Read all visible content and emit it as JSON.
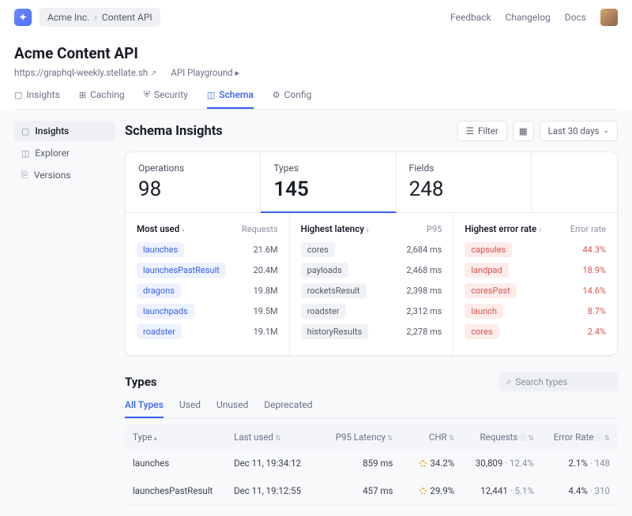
{
  "topbar": {
    "org": "Acme Inc.",
    "project": "Content API",
    "links": [
      "Feedback",
      "Changelog",
      "Docs"
    ]
  },
  "header": {
    "title": "Acme Content API",
    "url": "https://graphql-weekly.stellate.sh",
    "playground": "API Playground"
  },
  "tabs": [
    {
      "label": "Insights"
    },
    {
      "label": "Caching"
    },
    {
      "label": "Security"
    },
    {
      "label": "Schema",
      "active": true
    },
    {
      "label": "Config"
    }
  ],
  "side": [
    {
      "label": "Insights",
      "active": true
    },
    {
      "label": "Explorer"
    },
    {
      "label": "Versions"
    }
  ],
  "section_title": "Schema Insights",
  "filter": "Filter",
  "range": "Last 30 days",
  "stats": [
    {
      "label": "Operations",
      "value": "98"
    },
    {
      "label": "Types",
      "value": "145",
      "active": true
    },
    {
      "label": "Fields",
      "value": "248"
    }
  ],
  "lists": [
    {
      "title": "Most used",
      "metric": "Requests",
      "style": "blue",
      "rows": [
        {
          "name": "launches",
          "val": "21.6M"
        },
        {
          "name": "launchesPastResult",
          "val": "20.4M"
        },
        {
          "name": "dragons",
          "val": "19.8M"
        },
        {
          "name": "launchpads",
          "val": "19.5M"
        },
        {
          "name": "roadster",
          "val": "19.1M"
        }
      ]
    },
    {
      "title": "Highest latency",
      "metric": "P95",
      "style": "neutral",
      "rows": [
        {
          "name": "cores",
          "val": "2,684 ms"
        },
        {
          "name": "payloads",
          "val": "2,468 ms"
        },
        {
          "name": "rocketsResult",
          "val": "2,398 ms"
        },
        {
          "name": "roadster",
          "val": "2,312 ms"
        },
        {
          "name": "historyResults",
          "val": "2,278 ms"
        }
      ]
    },
    {
      "title": "Highest error rate",
      "metric": "Error rate",
      "style": "warm",
      "rows": [
        {
          "name": "capsules",
          "val": "44.3%"
        },
        {
          "name": "landpad",
          "val": "18.9%"
        },
        {
          "name": "coresPast",
          "val": "14.6%"
        },
        {
          "name": "launch",
          "val": "8.7%"
        },
        {
          "name": "cores",
          "val": "2.4%"
        }
      ]
    }
  ],
  "types_section": {
    "title": "Types",
    "search_placeholder": "Search types",
    "tabs": [
      "All Types",
      "Used",
      "Unused",
      "Deprecated"
    ],
    "columns": {
      "type": "Type",
      "last": "Last used",
      "p95": "P95 Latency",
      "chr": "CHR",
      "req": "Requests",
      "err": "Error Rate"
    },
    "rows": [
      {
        "type": "launches",
        "last": "Dec 11, 19:34:12",
        "p95": "859 ms",
        "chr": "34.2%",
        "req": "30,809",
        "req_sub": "12.4%",
        "err": "2.1%",
        "err_sub": "148"
      },
      {
        "type": "launchesPastResult",
        "last": "Dec 11, 19:12:55",
        "p95": "457 ms",
        "chr": "29.9%",
        "req": "12,441",
        "req_sub": "5.1%",
        "err": "4.4%",
        "err_sub": "310"
      }
    ]
  }
}
